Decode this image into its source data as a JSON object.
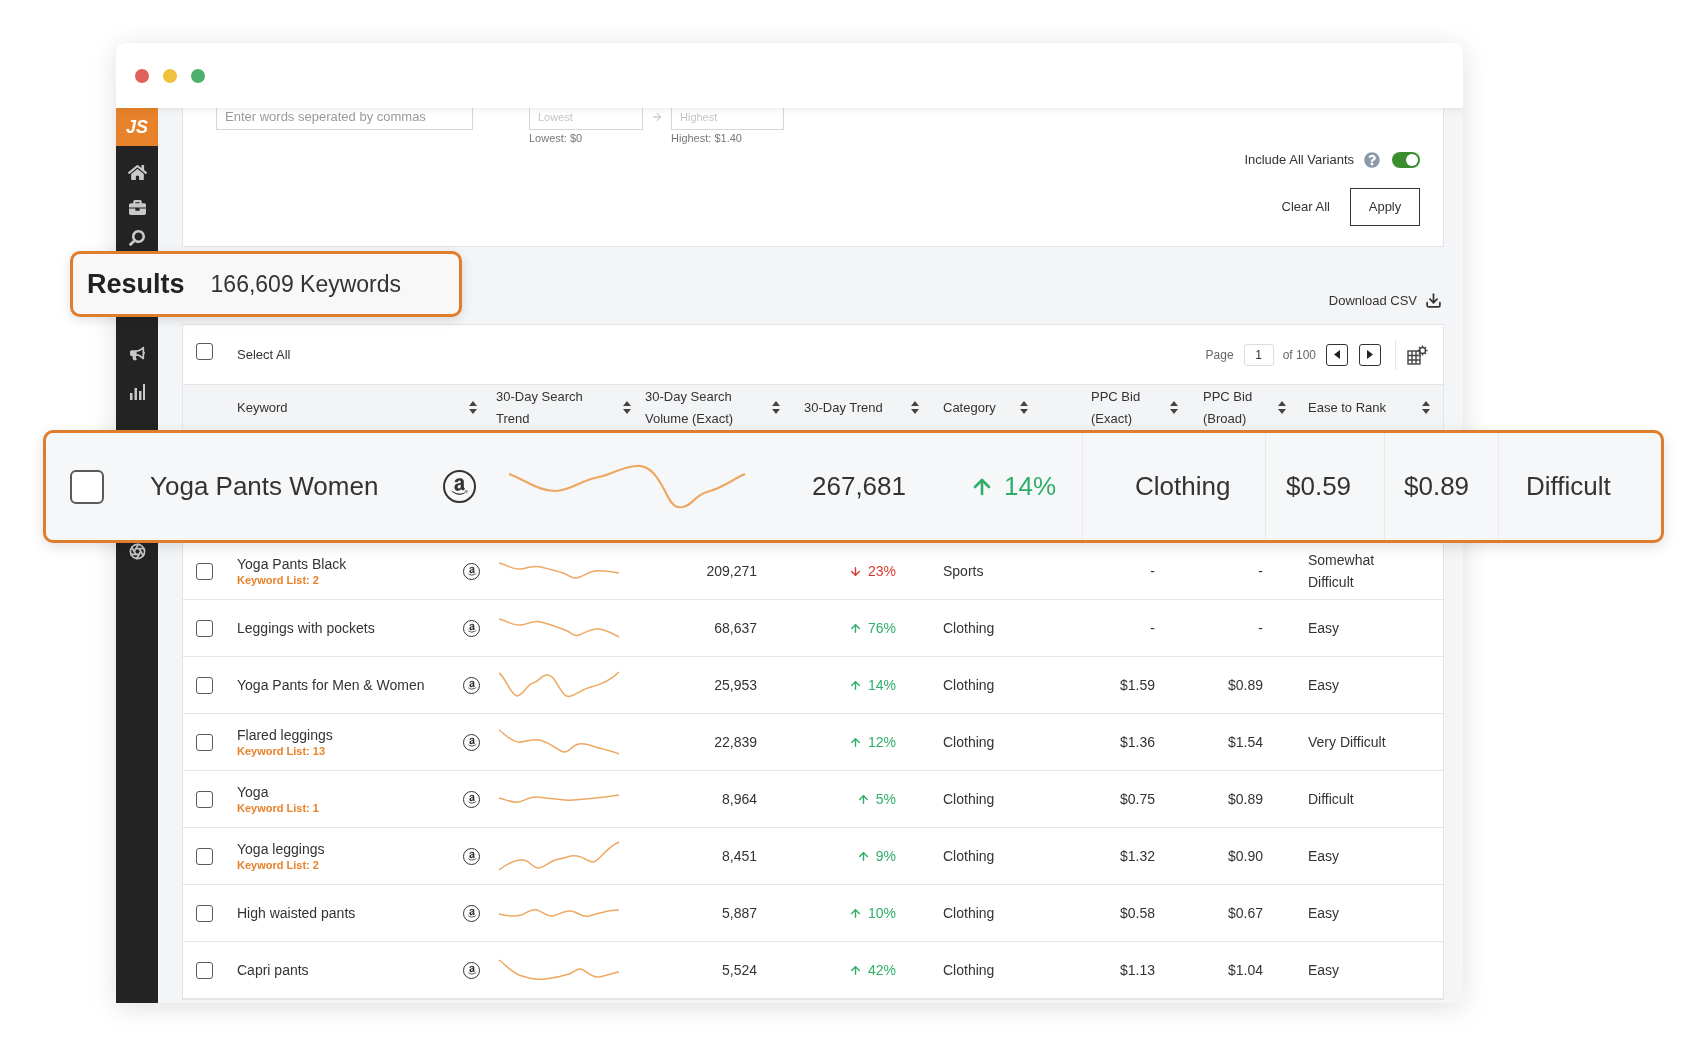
{
  "sidebar": {
    "logo": "JS"
  },
  "filters": {
    "keyword_field": {
      "placeholder": "Enter words seperated by commas"
    },
    "price_min": {
      "placeholder": "Lowest",
      "caption": "Lowest: $0"
    },
    "price_max": {
      "placeholder": "Highest",
      "caption": "Highest: $1.40"
    },
    "include_all_variants": {
      "label": "Include All Variants",
      "on": true
    },
    "clear_all": "Clear All",
    "apply": "Apply"
  },
  "results": {
    "title": "Results",
    "count": "166,609 Keywords",
    "download": "Download CSV"
  },
  "table": {
    "select_all": {
      "label": "Select All",
      "checked": false
    },
    "pagination": {
      "label": "Page",
      "page": "1",
      "total": "of 100"
    },
    "columns": [
      "Keyword",
      "30-Day Search Trend",
      "30-Day Search Volume (Exact)",
      "30-Day Trend",
      "Category",
      "PPC Bid (Exact)",
      "PPC Bid (Broad)",
      "Ease to Rank"
    ],
    "highlighted_row": {
      "keyword": "Yoga Pants Women",
      "checked": false,
      "volume": "267,681",
      "trend": {
        "rising": true,
        "value": "14%"
      },
      "category": "Clothing",
      "ppc_exact": "$0.59",
      "ppc_broad": "$0.89",
      "ease": "Difficult"
    },
    "rows": [
      {
        "keyword": "Yoga Pants Black",
        "list": "Keyword List: 2",
        "checked": false,
        "volume": "209,271",
        "trend": {
          "rising": false,
          "value": "23%"
        },
        "category": "Sports",
        "ppc_exact": "-",
        "ppc_broad": "-",
        "ease": "Somewhat Difficult"
      },
      {
        "keyword": "Leggings with pockets",
        "checked": false,
        "volume": "68,637",
        "trend": {
          "rising": true,
          "value": "76%"
        },
        "category": "Clothing",
        "ppc_exact": "-",
        "ppc_broad": "-",
        "ease": "Easy"
      },
      {
        "keyword": "Yoga Pants for Men & Women",
        "checked": false,
        "volume": "25,953",
        "trend": {
          "rising": true,
          "value": "14%"
        },
        "category": "Clothing",
        "ppc_exact": "$1.59",
        "ppc_broad": "$0.89",
        "ease": "Easy"
      },
      {
        "keyword": "Flared leggings",
        "list": "Keyword List: 13",
        "checked": false,
        "volume": "22,839",
        "trend": {
          "rising": true,
          "value": "12%"
        },
        "category": "Clothing",
        "ppc_exact": "$1.36",
        "ppc_broad": "$1.54",
        "ease": "Very Difficult"
      },
      {
        "keyword": "Yoga",
        "list": "Keyword List: 1",
        "checked": false,
        "volume": "8,964",
        "trend": {
          "rising": true,
          "value": "5%"
        },
        "category": "Clothing",
        "ppc_exact": "$0.75",
        "ppc_broad": "$0.89",
        "ease": "Difficult"
      },
      {
        "keyword": "Yoga leggings",
        "list": "Keyword List: 2",
        "checked": false,
        "volume": "8,451",
        "trend": {
          "rising": true,
          "value": "9%"
        },
        "category": "Clothing",
        "ppc_exact": "$1.32",
        "ppc_broad": "$0.90",
        "ease": "Easy"
      },
      {
        "keyword": "High waisted pants",
        "checked": false,
        "volume": "5,887",
        "trend": {
          "rising": true,
          "value": "10%"
        },
        "category": "Clothing",
        "ppc_exact": "$0.58",
        "ppc_broad": "$0.67",
        "ease": "Easy"
      },
      {
        "keyword": "Capri pants",
        "checked": false,
        "volume": "5,524",
        "trend": {
          "rising": true,
          "value": "42%"
        },
        "category": "Clothing",
        "ppc_exact": "$1.13",
        "ppc_broad": "$1.04",
        "ease": "Easy"
      }
    ]
  }
}
